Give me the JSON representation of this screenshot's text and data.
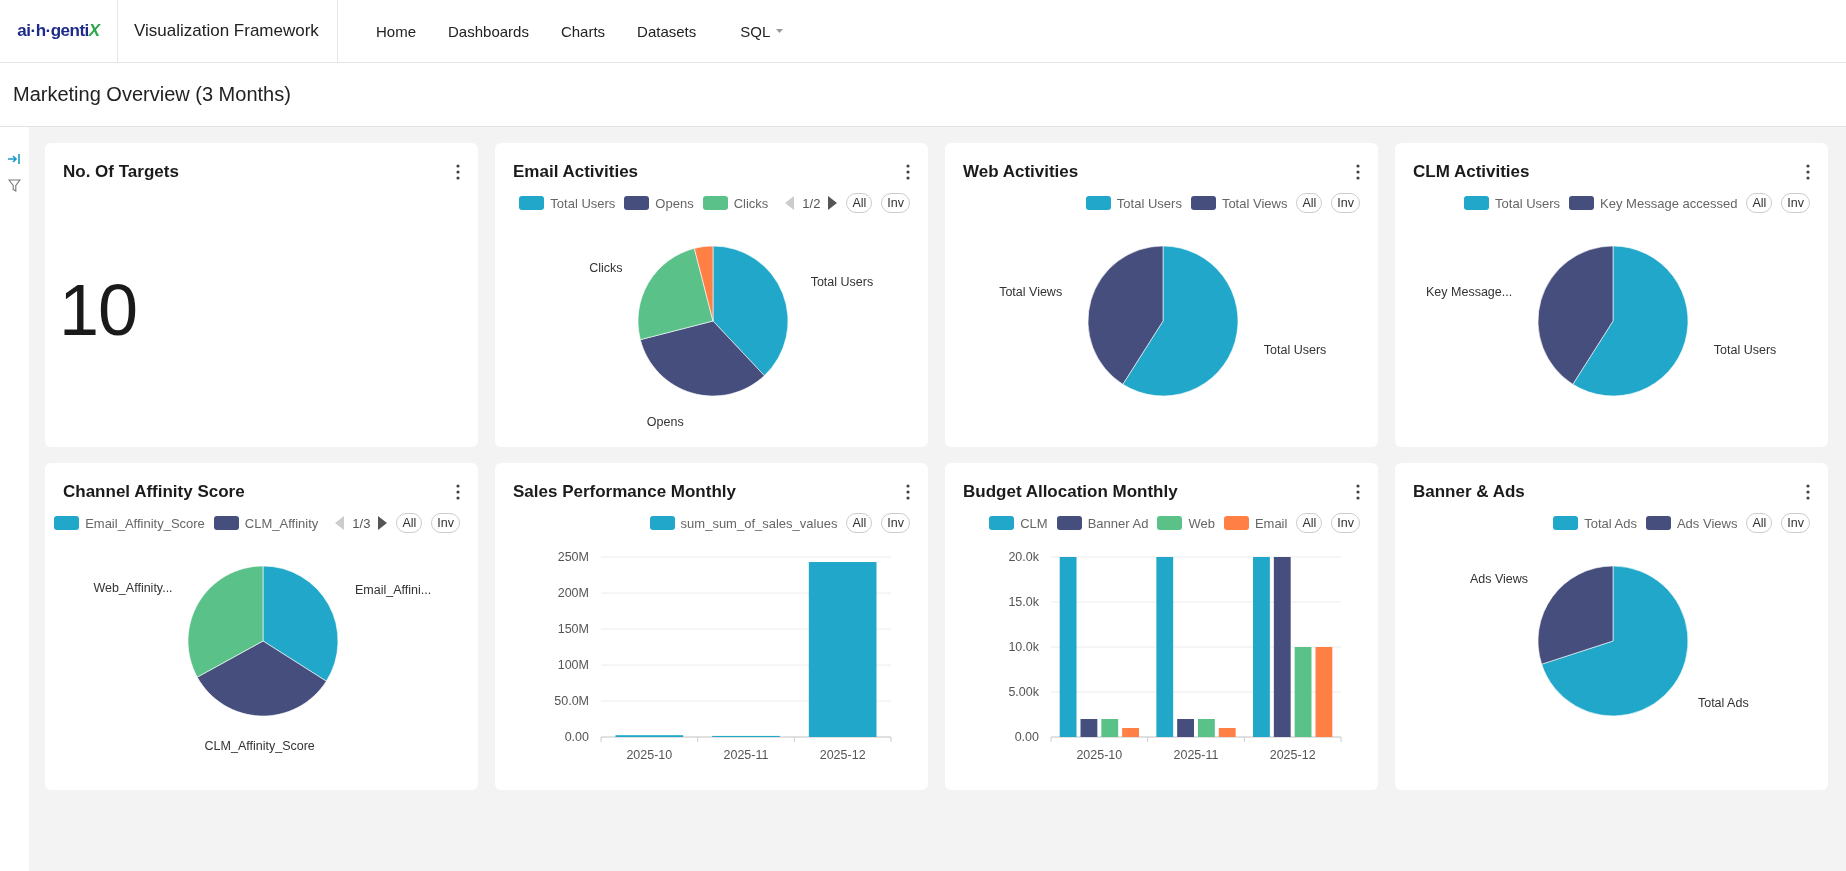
{
  "header": {
    "logo": "ai·h·gentiX",
    "app_name": "Visualization Framework",
    "nav": [
      {
        "label": "Home",
        "dropdown": false
      },
      {
        "label": "Dashboards",
        "dropdown": false
      },
      {
        "label": "Charts",
        "dropdown": false
      },
      {
        "label": "Datasets",
        "dropdown": false
      },
      {
        "label": "SQL",
        "dropdown": true
      }
    ]
  },
  "page_title": "Marketing Overview (3 Months)",
  "cards": [
    {
      "kind": "number",
      "title": "No. Of Targets",
      "value": "10"
    },
    {
      "kind": "pie",
      "title": "Email Activities",
      "legend": {
        "items": [
          {
            "label": "Total Users",
            "color": "#20a7c9"
          },
          {
            "label": "Opens",
            "color": "#454e7c"
          },
          {
            "label": "Clicks",
            "color": "#5ac189"
          }
        ],
        "pager": {
          "text": "1/2",
          "prev_disabled": true,
          "next_disabled": false
        },
        "buttons": [
          "All",
          "Inv"
        ]
      },
      "chart_data": {
        "type": "pie",
        "categories": [
          "Total Users",
          "Opens",
          "Clicks",
          null
        ],
        "values": [
          38,
          33,
          25,
          4
        ],
        "colors": [
          "#20a7c9",
          "#454e7c",
          "#5ac189",
          "#ff7f44"
        ]
      }
    },
    {
      "kind": "pie",
      "title": "Web Activities",
      "legend": {
        "items": [
          {
            "label": "Total Users",
            "color": "#20a7c9"
          },
          {
            "label": "Total Views",
            "color": "#454e7c"
          }
        ],
        "buttons": [
          "All",
          "Inv"
        ]
      },
      "chart_data": {
        "type": "pie",
        "categories": [
          "Total Users",
          "Total Views"
        ],
        "values": [
          59,
          41
        ],
        "colors": [
          "#20a7c9",
          "#454e7c"
        ]
      }
    },
    {
      "kind": "pie",
      "title": "CLM Activities",
      "legend": {
        "items": [
          {
            "label": "Total Users",
            "color": "#20a7c9"
          },
          {
            "label": "Key Message accessed",
            "color": "#454e7c"
          }
        ],
        "buttons": [
          "All",
          "Inv"
        ]
      },
      "chart_data": {
        "type": "pie",
        "categories": [
          "Total Users",
          "Key Message..."
        ],
        "values": [
          59,
          41
        ],
        "colors": [
          "#20a7c9",
          "#454e7c"
        ]
      }
    },
    {
      "kind": "pie",
      "title": "Channel Affinity Score",
      "legend": {
        "items": [
          {
            "label": "Email_Affinity_Score",
            "color": "#20a7c9"
          },
          {
            "label": "CLM_Affinity",
            "color": "#454e7c"
          }
        ],
        "pager": {
          "text": "1/3",
          "prev_disabled": true,
          "next_disabled": false
        },
        "buttons": [
          "All",
          "Inv"
        ]
      },
      "chart_data": {
        "type": "pie",
        "categories": [
          "Email_Affini...",
          "CLM_Affinity_Score",
          "Web_Affinity..."
        ],
        "values": [
          34,
          33,
          33
        ],
        "colors": [
          "#20a7c9",
          "#454e7c",
          "#5ac189"
        ]
      }
    },
    {
      "kind": "bar",
      "title": "Sales Performance Monthly",
      "legend": {
        "buttons": [
          "All",
          "Inv"
        ]
      },
      "chart_data": {
        "type": "bar",
        "grid": true,
        "categories": [
          "2025-10",
          "2025-11",
          "2025-12"
        ],
        "series": [
          {
            "name": "sum_sum_of_sales_values",
            "color": "#20a7c9",
            "values": [
              2500000,
              1500000,
              243000000
            ]
          }
        ],
        "ylim": [
          0,
          250000000
        ],
        "yticks": [
          {
            "value": 0,
            "label": "0.00"
          },
          {
            "value": 50000000,
            "label": "50.0M"
          },
          {
            "value": 100000000,
            "label": "100M"
          },
          {
            "value": 150000000,
            "label": "150M"
          },
          {
            "value": 200000000,
            "label": "200M"
          },
          {
            "value": 250000000,
            "label": "250M"
          }
        ]
      }
    },
    {
      "kind": "bar",
      "title": "Budget Allocation Monthly",
      "legend": {
        "buttons": [
          "All",
          "Inv"
        ]
      },
      "chart_data": {
        "type": "bar",
        "grid": true,
        "categories": [
          "2025-10",
          "2025-11",
          "2025-12"
        ],
        "series": [
          {
            "name": "CLM",
            "color": "#20a7c9",
            "values": [
              20000,
              20000,
              20000
            ]
          },
          {
            "name": "Banner Ad",
            "color": "#454e7c",
            "values": [
              2000,
              2000,
              20000
            ]
          },
          {
            "name": "Web",
            "color": "#5ac189",
            "values": [
              2000,
              2000,
              10000
            ]
          },
          {
            "name": "Email",
            "color": "#ff7f44",
            "values": [
              1000,
              1000,
              10000
            ]
          }
        ],
        "ylim": [
          0,
          20000
        ],
        "yticks": [
          {
            "value": 0,
            "label": "0.00"
          },
          {
            "value": 5000,
            "label": "5.00k"
          },
          {
            "value": 10000,
            "label": "10.0k"
          },
          {
            "value": 15000,
            "label": "15.0k"
          },
          {
            "value": 20000,
            "label": "20.0k"
          }
        ]
      }
    },
    {
      "kind": "pie",
      "title": "Banner & Ads",
      "legend": {
        "items": [
          {
            "label": "Total Ads",
            "color": "#20a7c9"
          },
          {
            "label": "Ads Views",
            "color": "#454e7c"
          }
        ],
        "buttons": [
          "All",
          "Inv"
        ]
      },
      "chart_data": {
        "type": "pie",
        "categories": [
          "Total Ads",
          "Ads Views"
        ],
        "values": [
          70,
          30
        ],
        "colors": [
          "#20a7c9",
          "#454e7c"
        ]
      }
    }
  ]
}
